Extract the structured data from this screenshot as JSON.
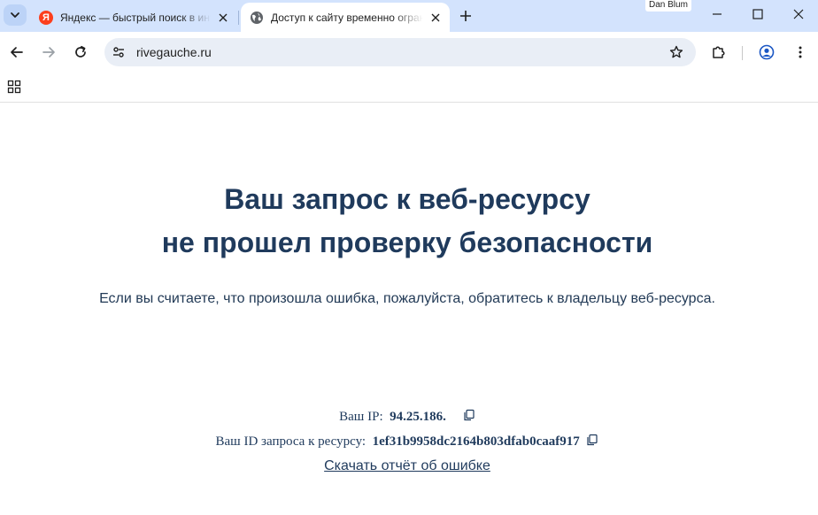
{
  "browser": {
    "tabs": [
      {
        "title": "Яндекс — быстрый поиск в интернете",
        "active": false,
        "favicon": "yandex-icon",
        "favicon_letter": "Я"
      },
      {
        "title": "Доступ к сайту временно ограничен",
        "active": true,
        "favicon": "globe-icon"
      }
    ],
    "profile_name": "Dan Blum",
    "url": "rivegauche.ru",
    "colors": {
      "tabstrip": "#d3e3fd",
      "omnibox": "#e9eef6",
      "yandex": "#fc3f1d"
    }
  },
  "page": {
    "heading_line1": "Ваш запрос к веб-ресурсу",
    "heading_line2": "не прошел проверку безопасности",
    "subtext": "Если вы считаете, что произошла ошибка, пожалуйста, обратитесь к владельцу веб-ресурса.",
    "ip_label": "Ваш IP:",
    "ip_value": "94.25.186.",
    "request_id_label": "Ваш ID запроса к ресурсу:",
    "request_id_value": "1ef31b9958dc2164b803dfab0caaf917",
    "report_link": "Скачать отчёт об ошибке",
    "colors": {
      "heading": "#1f3a5c",
      "text": "#223a56"
    }
  }
}
